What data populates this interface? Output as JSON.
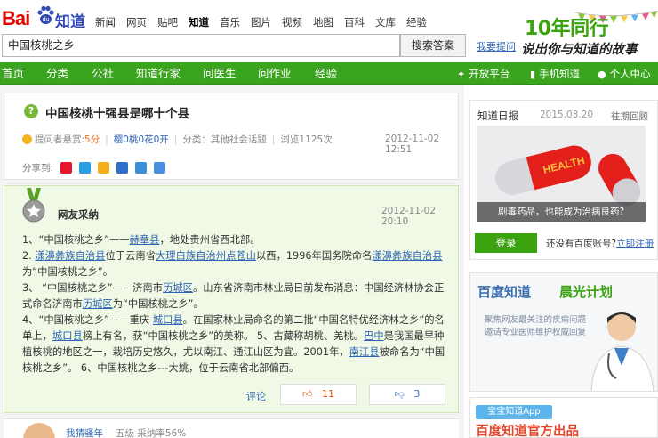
{
  "header": {
    "logo_bai": "Bai",
    "logo_du": "du",
    "logo_zhidao": "知道",
    "nav": [
      "新闻",
      "网页",
      "贴吧",
      "知道",
      "音乐",
      "图片",
      "视频",
      "地图",
      "百科",
      "文库",
      "经验"
    ],
    "active_nav": "知道",
    "search_value": "中国核桃之乡",
    "search_button": "搜索答案",
    "help_link": "我要提问",
    "banner_big": "10年同行",
    "banner_small": "说出你与知道的故事"
  },
  "mainnav": {
    "items": [
      "首页",
      "分类",
      "公社",
      "知道行家",
      "问医生",
      "问作业",
      "经验"
    ],
    "right": [
      "开放平台",
      "手机知道",
      "个人中心"
    ]
  },
  "question": {
    "title": "中国核桃十强县是哪十个县",
    "reward_label": "提问者悬赏:",
    "reward_value": "5分",
    "asker": "樱0桃0花0开",
    "category": "分类：其他社会话题",
    "views": "浏览1125次",
    "date": "2012-11-02 12:51",
    "share_label": "分享到:"
  },
  "answer": {
    "label": "网友采纳",
    "date": "2012-11-02 20:10",
    "lines": [
      {
        "parts": [
          [
            "t",
            "1、“中国核桃之乡”——"
          ],
          [
            "l",
            "赫章县"
          ],
          [
            "t",
            "，地处贵州省西北部。"
          ]
        ]
      },
      {
        "parts": [
          [
            "t",
            "2. "
          ],
          [
            "l",
            "漾濞彝族自治县"
          ],
          [
            "t",
            "位于云南省"
          ],
          [
            "l",
            "大理白族自治州"
          ],
          [
            "l",
            "点苍山"
          ],
          [
            "t",
            "以西，1996年国务院命名"
          ],
          [
            "l",
            "漾濞彝族自治县"
          ],
          [
            "t",
            "为“中国核桃之乡”。"
          ]
        ]
      },
      {
        "parts": [
          [
            "t",
            "3、 “中国核桃之乡”——济南市"
          ],
          [
            "l",
            "历城区"
          ],
          [
            "t",
            "。山东省济南市林业局日前发布消息：中国经济林协会正式命名济南市"
          ],
          [
            "l",
            "历城区"
          ],
          [
            "t",
            "为“中国核桃之乡”。"
          ]
        ]
      },
      {
        "parts": [
          [
            "t",
            "4、“中国核桃之乡”——重庆 "
          ],
          [
            "l",
            "城口县"
          ],
          [
            "t",
            "。在国家林业局命名的第二批“中国名特优经济林之乡”的名单上，"
          ],
          [
            "l",
            "城口县"
          ],
          [
            "t",
            "榜上有名，获“中国核桃之乡”的美称。 5、古藏称胡桃、羌桃。"
          ],
          [
            "l",
            "巴中"
          ],
          [
            "t",
            "是我国最早种植核桃的地区之一，栽培历史悠久，尤以南江、通江山区为宜。2001年，"
          ],
          [
            "l",
            "南江县"
          ],
          [
            "t",
            "被命名为“中国核桃之乡”。 6、中国核桃之乡---大姚，位于云南省北部偏西。"
          ]
        ]
      }
    ],
    "comment": "评论",
    "likes": "11",
    "dislikes": "3"
  },
  "next_answer": {
    "user": "我猜骚年",
    "meta": "五级   采纳率56%"
  },
  "sidebar": {
    "daily_title": "知道日报",
    "daily_date": "2015.03.20",
    "daily_more": "往期回顾",
    "daily_image_text": "HEALTH",
    "daily_caption": "剧毒药品，也能成为治病良药?",
    "login": "登录",
    "no_account": "还没有百度账号?",
    "register": "立即注册",
    "promo_t1": "百度知道",
    "promo_t2": "晨光计划",
    "promo_l1": "聚焦网友最关注的疾病问题",
    "promo_l2": "邀请专业医师维护权威回复",
    "promo2_tag": "宝宝知道App",
    "promo2_title": "百度知道官方出品"
  },
  "colors": {
    "brand_green": "#3ba41f",
    "link": "#2d64b3",
    "baidu_red": "#e10601"
  }
}
